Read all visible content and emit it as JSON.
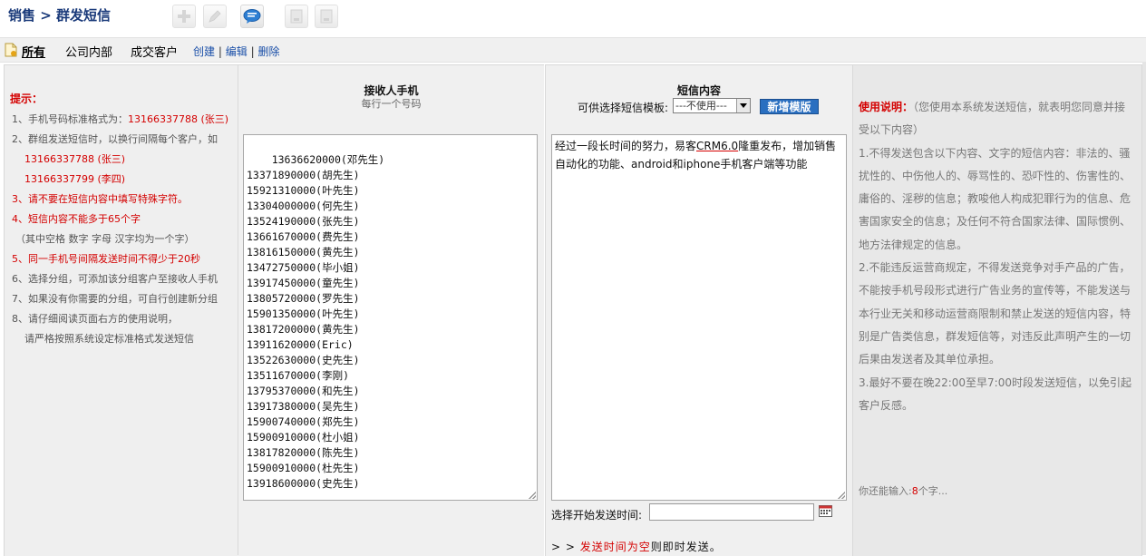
{
  "header": {
    "breadcrumb": "销售 > 群发短信"
  },
  "toolbar": {
    "add": "add-icon",
    "edit": "edit-icon",
    "sms": "chat-icon",
    "export": "export-icon",
    "import": "import-icon"
  },
  "filter": {
    "all": "所有",
    "internal": "公司内部",
    "closed": "成交客户",
    "create": "创建",
    "edit": "编辑",
    "delete": "删除",
    "sep": "|"
  },
  "tips": {
    "heading": "提示：",
    "t1a": "1、手机号码标准格式为：",
    "t1b": "13166337788 (张三)",
    "t2a": "2、群组发送短信时，以换行间隔每个客户，如",
    "t2b": "13166337788 (张三)",
    "t2c": "13166337799 (李四)",
    "t3": "3、请不要在短信内容中填写特殊字符。",
    "t4": "4、短信内容不能多于65个字",
    "t4b": "（其中空格  数字  字母  汉字均为一个字）",
    "t5": "5、同一手机号间隔发送时间不得少于20秒",
    "t6": "6、选择分组，可添加该分组客户至接收人手机",
    "t7": "7、如果没有你需要的分组，可自行创建新分组",
    "t8": "8、请仔细阅读页面右方的使用说明，",
    "t8b": "请严格按照系统设定标准格式发送短信"
  },
  "receivers": {
    "title": "接收人手机",
    "subtitle": "每行一个号码",
    "list": "13636620000(邓先生)\n13371890000(胡先生)\n15921310000(叶先生)\n13304000000(何先生)\n13524190000(张先生)\n13661670000(费先生)\n13816150000(黄先生)\n13472750000(毕小姐)\n13917450000(童先生)\n13805720000(罗先生)\n15901350000(叶先生)\n13817200000(黄先生)\n13911620000(Eric)\n13522630000(史先生)\n13511670000(李刚)\n13795370000(和先生)\n13917380000(吴先生)\n15900740000(郑先生)\n15900910000(杜小姐)\n13817820000(陈先生)\n15900910000(杜先生)\n13918600000(史先生)"
  },
  "sms": {
    "title": "短信内容",
    "template_label": "可供选择短信模板:",
    "template_value": "---不使用---",
    "new_template": "新增模版",
    "content_a": "经过一段长时间的努力，易客",
    "content_u": "CRM6.0",
    "content_b": "隆重发布，增加销售自动化的功能、android和iphone手机客户端等功能",
    "send_time_label": "选择开始发送时间:",
    "send_time_value": "",
    "note_prefix": "> > ",
    "note_red": "发送时间为空",
    "note_suffix": "则即时发送。"
  },
  "usage": {
    "label": "使用说明：",
    "intro": "（您使用本系统发送短信，就表明您同意并接受以下内容）",
    "p1": "1.不得发送包含以下内容、文字的短信内容：非法的、骚扰性的、中伤他人的、辱骂性的、恐吓性的、伤害性的、庸俗的、淫秽的信息；教唆他人构成犯罪行为的信息、危害国家安全的信息；及任何不符合国家法律、国际惯例、地方法律规定的信息。",
    "p2": "2.不能违反运营商规定，不得发送竞争对手产品的广告，不能按手机号段形式进行广告业务的宣传等，不能发送与本行业无关和移动运营商限制和禁止发送的短信内容，特别是广告类信息，群发短信等，对违反此声明产生的一切后果由发送者及其单位承担。",
    "p3": "3.最好不要在晚22:00至早7:00时段发送短信，以免引起客户反感。",
    "remain_a": "你还能输入:",
    "remain_n": "8",
    "remain_b": "个字..."
  }
}
